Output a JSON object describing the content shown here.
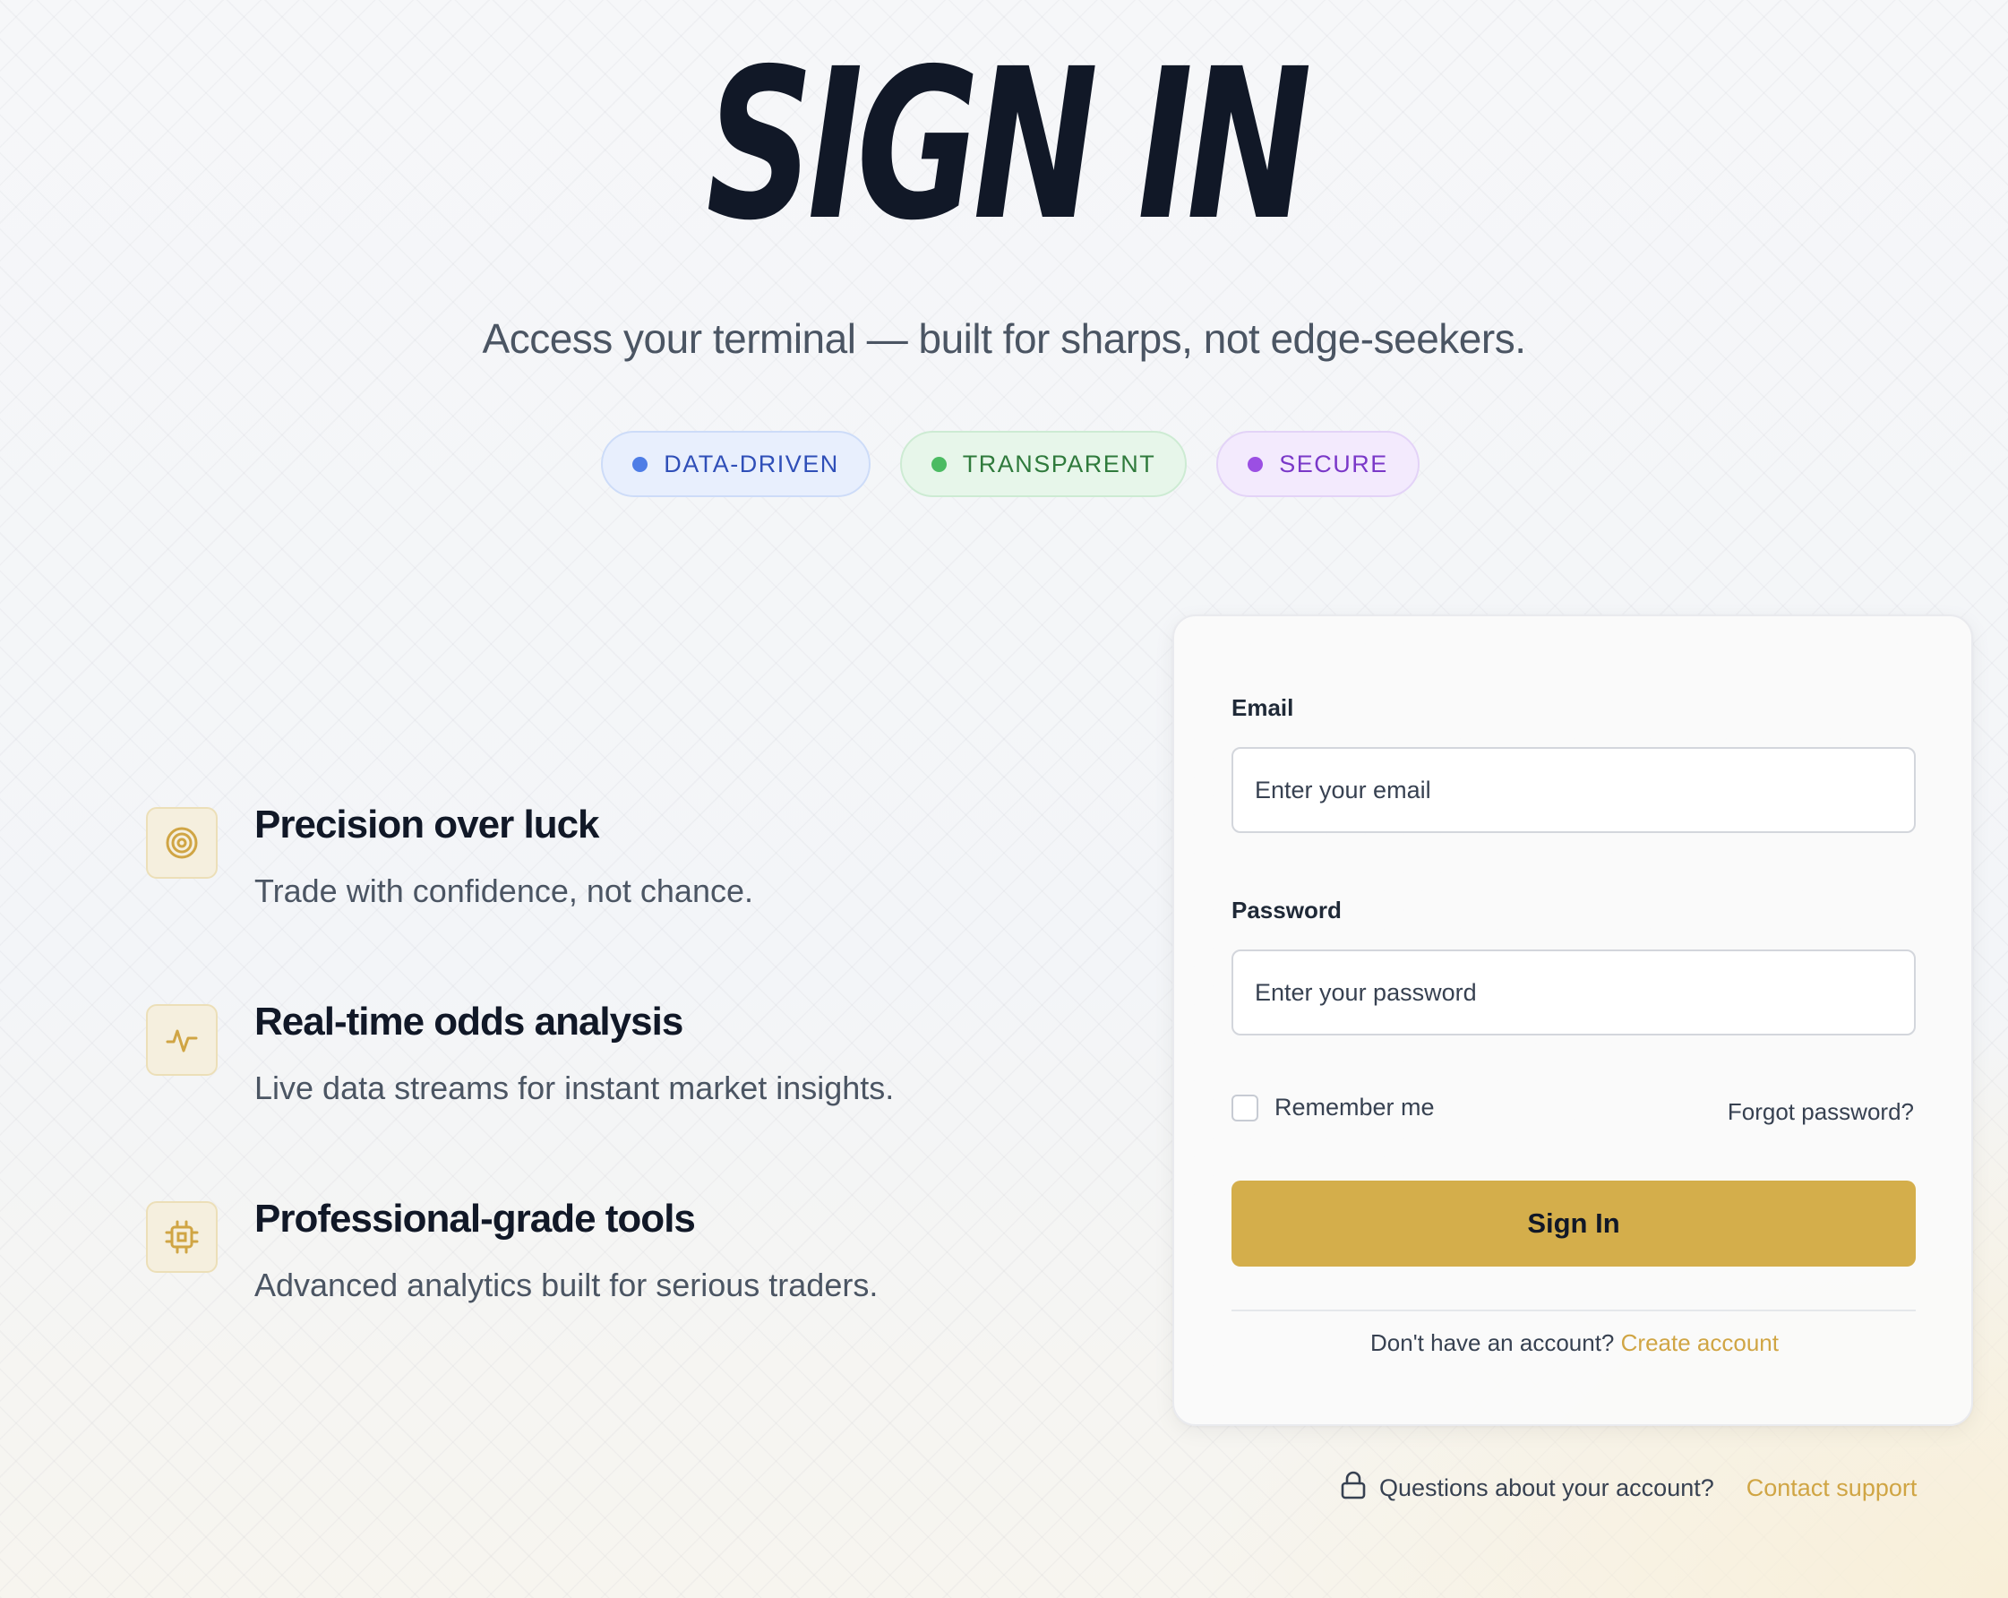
{
  "hero": {
    "title": "SIGN IN",
    "subtitle": "Access your terminal — built for sharps, not edge-seekers."
  },
  "badges": [
    {
      "label": "DATA-DRIVEN",
      "color": "#4e7de6"
    },
    {
      "label": "TRANSPARENT",
      "color": "#4cbb63"
    },
    {
      "label": "SECURE",
      "color": "#9b4fe3"
    }
  ],
  "features": [
    {
      "icon": "target-icon",
      "title": "Precision over luck",
      "description": "Trade with confidence, not chance."
    },
    {
      "icon": "activity-icon",
      "title": "Real-time odds analysis",
      "description": "Live data streams for instant market insights."
    },
    {
      "icon": "cpu-icon",
      "title": "Professional-grade tools",
      "description": "Advanced analytics built for serious traders."
    }
  ],
  "form": {
    "email_label": "Email",
    "email_placeholder": "Enter your email",
    "email_value": "",
    "password_label": "Password",
    "password_placeholder": "Enter your password",
    "password_value": "",
    "remember_label": "Remember me",
    "remember_checked": false,
    "forgot_label": "Forgot password?",
    "submit_label": "Sign In",
    "no_account_text": "Don't have an account?",
    "create_account_label": "Create account"
  },
  "footer": {
    "icon": "lock-icon",
    "question_text": "Questions about your account?",
    "support_label": "Contact support"
  },
  "colors": {
    "accent": "#d4ae4b",
    "link": "#d0a544",
    "heading": "#111827"
  }
}
